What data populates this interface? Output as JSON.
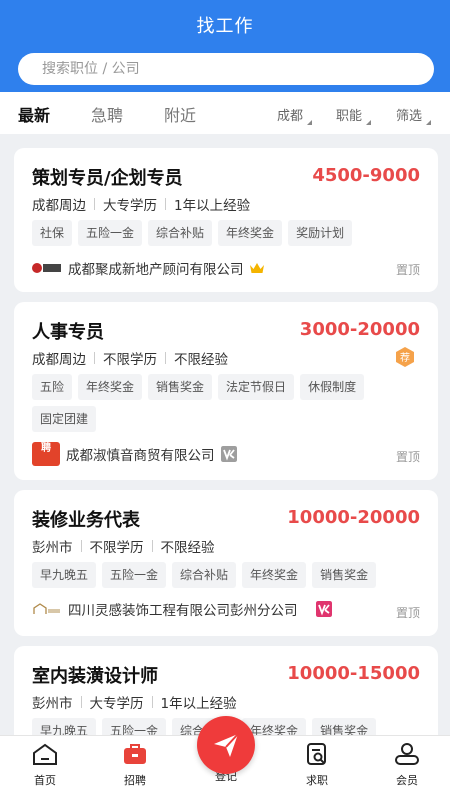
{
  "header": {
    "title": "找工作"
  },
  "search": {
    "placeholder": "搜索职位 / 公司"
  },
  "tabs": [
    {
      "label": "最新",
      "active": true
    },
    {
      "label": "急聘",
      "active": false
    },
    {
      "label": "附近",
      "active": false
    }
  ],
  "filters": [
    {
      "label": "成都"
    },
    {
      "label": "职能"
    },
    {
      "label": "筛选"
    }
  ],
  "jobs": [
    {
      "title": "策划专员/企划专员",
      "salary": "4500-9000",
      "location": "成都周边",
      "education": "大专学历",
      "experience": "1年以上经验",
      "tags": [
        "社保",
        "五险一金",
        "综合补贴",
        "年终奖金",
        "奖励计划"
      ],
      "company": "成都聚成新地产顾问有限公司",
      "company_logo_icon": "company-logo-icon",
      "badge_icon": "crown-icon",
      "pin": "置顶"
    },
    {
      "title": "人事专员",
      "salary": "3000-20000",
      "location": "成都周边",
      "education": "不限学历",
      "experience": "不限经验",
      "tags": [
        "五险",
        "年终奖金",
        "销售奖金",
        "法定节假日",
        "休假制度",
        "固定团建"
      ],
      "company": "成都淑慎音商贸有限公司",
      "company_logo_text": "聘",
      "recommend_badge": "荐",
      "badge_icon": "verified-icon",
      "pin": "置顶"
    },
    {
      "title": "装修业务代表",
      "salary": "10000-20000",
      "location": "彭州市",
      "education": "不限学历",
      "experience": "不限经验",
      "tags": [
        "早九晚五",
        "五险一金",
        "综合补贴",
        "年终奖金",
        "销售奖金"
      ],
      "company": "四川灵感装饰工程有限公司彭州分公司",
      "badge_icon": "verified-icon",
      "pin": "置顶"
    },
    {
      "title": "室内装潢设计师",
      "salary": "10000-15000",
      "location": "彭州市",
      "education": "大专学历",
      "experience": "1年以上经验",
      "tags": [
        "早九晚五",
        "五险一金",
        "综合补贴",
        "年终奖金",
        "销售奖金"
      ]
    }
  ],
  "bottom_nav": [
    {
      "label": "首页",
      "icon": "home-icon"
    },
    {
      "label": "招聘",
      "icon": "briefcase-icon"
    },
    {
      "label": "登记",
      "icon": "paper-plane-icon"
    },
    {
      "label": "求职",
      "icon": "search-doc-icon"
    },
    {
      "label": "会员",
      "icon": "user-icon"
    }
  ],
  "colors": {
    "primary": "#2f80ed",
    "salary": "#e84a4a",
    "fab": "#ef3b3b",
    "briefcase": "#e8433a"
  }
}
